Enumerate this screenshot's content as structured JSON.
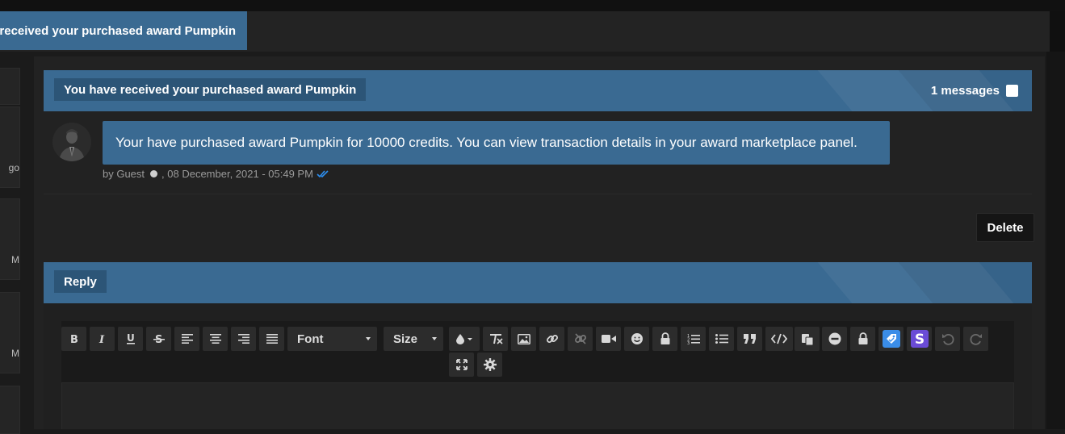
{
  "breadcrumb": {
    "active_label": "You have received your purchased award Pumpkin"
  },
  "sidebar": {
    "cards": [
      {
        "text": ""
      },
      {
        "text": "go"
      },
      {
        "text": "M"
      },
      {
        "text": "M"
      },
      {
        "text": ""
      }
    ]
  },
  "conversation": {
    "title": "You have received your purchased award Pumpkin",
    "count_label": "1 messages"
  },
  "message": {
    "body": "Your have purchased award Pumpkin for 10000 credits. You can view transaction details in your award marketplace panel.",
    "author_prefix": "by Guest",
    "timestamp": ", 08 December, 2021 - 05:49 PM"
  },
  "actions": {
    "delete_label": "Delete"
  },
  "reply": {
    "title": "Reply",
    "font_label": "Font",
    "size_label": "Size"
  },
  "colors": {
    "accent": "#3a6a92",
    "accent_dark": "#2c5577",
    "read_tick": "#2d8ff0"
  }
}
